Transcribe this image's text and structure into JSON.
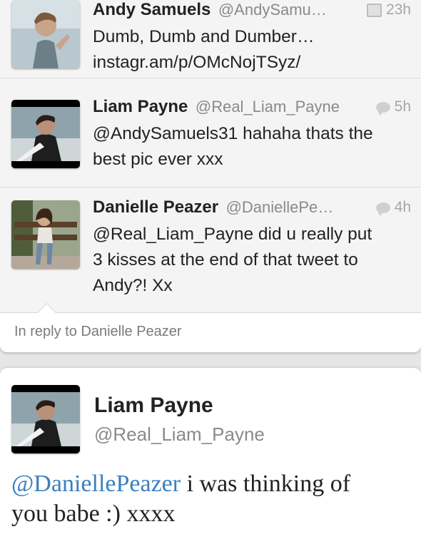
{
  "thread": {
    "tweets": [
      {
        "name": "Andy Samuels",
        "handle": "@AndySamu…",
        "time": "23h",
        "meta_icon": "photo-icon",
        "lines": [
          "Dumb, Dumb and Dumber…",
          "instagr.am/p/OMcNojTSyz/"
        ]
      },
      {
        "name": "Liam Payne",
        "handle": "@Real_Liam_Payne",
        "time": "5h",
        "meta_icon": "reply-bubble-icon",
        "lines": [
          "@AndySamuels31 hahaha thats the",
          "best pic ever xxx"
        ]
      },
      {
        "name": "Danielle Peazer",
        "handle": "@DaniellePe…",
        "time": "4h",
        "meta_icon": "reply-bubble-icon",
        "lines": [
          "@Real_Liam_Payne did u really put",
          "3 kisses at the end of that tweet to",
          "Andy?! Xx"
        ]
      }
    ],
    "reply_label": "In reply to Danielle Peazer"
  },
  "detail": {
    "name": "Liam Payne",
    "handle": "@Real_Liam_Payne",
    "mention": "@DaniellePeazer",
    "text_line1_rest": " i was thinking of",
    "text_line2": "you babe :) xxxx"
  },
  "colors": {
    "mention": "#3a7fc0",
    "meta_grey": "#a6a6a6",
    "background": "#e6e6e6"
  }
}
